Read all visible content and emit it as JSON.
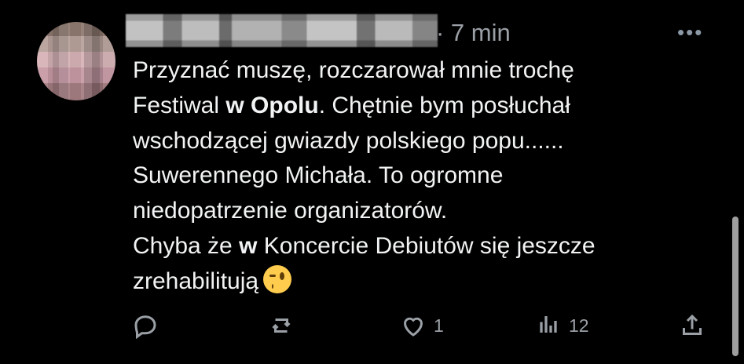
{
  "post": {
    "time": "· 7 min",
    "more": "•••",
    "body": {
      "l1": "Przyznać muszę, rozczarował mnie trochę",
      "l2a": "Festiwal ",
      "l2b": "w Opolu",
      "l2c": ". Chętnie bym posłuchał",
      "l3": "wschodzącej gwiazdy polskiego popu......",
      "l4": "Suwerennego Michała. To ogromne",
      "l5": "niedopatrzenie organizatorów.",
      "l6a": "Chyba że ",
      "l6b": "w",
      "l6c": " Koncercie Debiutów się jeszcze",
      "l7": "zrehabilitują",
      "emoji": "winking-face"
    },
    "actions": {
      "reply_icon": "reply-icon",
      "repost_icon": "repost-icon",
      "like_icon": "heart-icon",
      "like_count": "1",
      "views_icon": "views-icon",
      "views_count": "12",
      "share_icon": "share-icon"
    }
  }
}
